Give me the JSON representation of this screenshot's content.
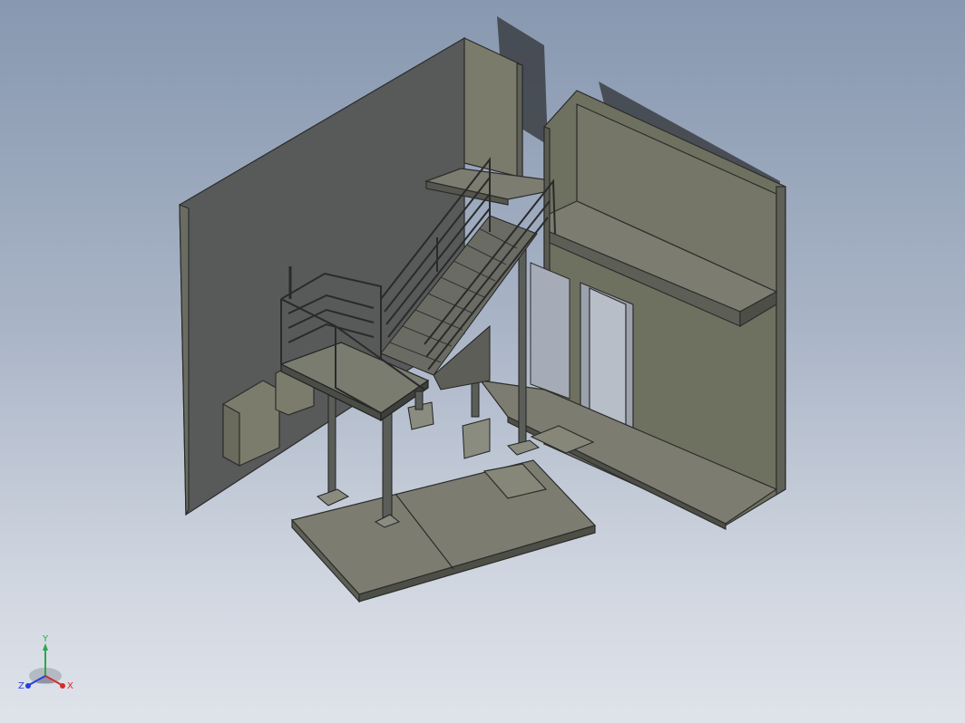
{
  "viewport": {
    "background_top": "#8798b0",
    "background_bottom": "#dfe3ea"
  },
  "model": {
    "description_icons": [
      "wall-left",
      "wall-back",
      "wall-right",
      "floor-ledge",
      "stair-flight",
      "landing-platform",
      "handrail",
      "support-column",
      "base-plate",
      "ground-slab",
      "electrical-box"
    ],
    "colors": {
      "wall_face_dark": "#575a58",
      "wall_face_mid": "#6e7060",
      "wall_face_light": "#7b7c6c",
      "wall_edge": "#2c2c2c",
      "slab_top": "#7c7d70",
      "shadow": "#3c3f44",
      "steel": "#5a5d58"
    }
  },
  "triad": {
    "x_label": "X",
    "y_label": "Y",
    "z_label": "Z",
    "x_color": "#d62a2a",
    "y_color": "#2aa84a",
    "z_color": "#2a3fd6"
  }
}
